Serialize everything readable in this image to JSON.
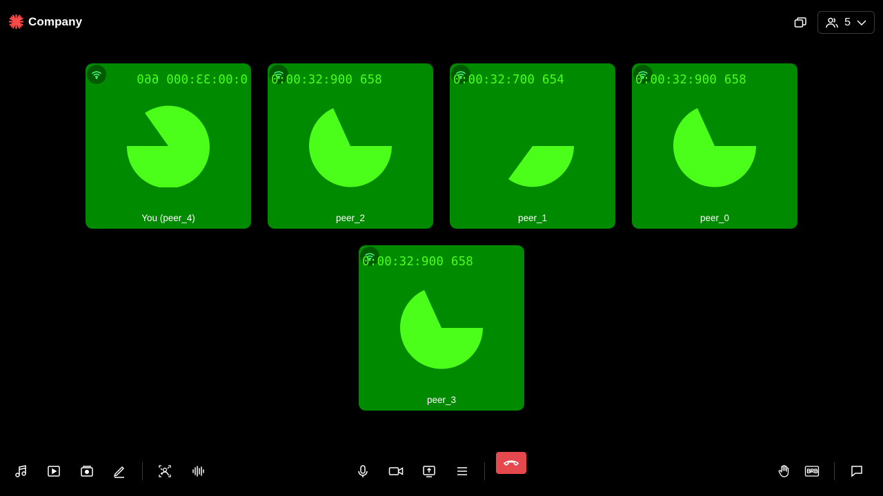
{
  "header": {
    "brand_name": "Company",
    "participant_count": "5",
    "icons": [
      "company-logo-icon",
      "pip-window-icon",
      "participants-icon",
      "chevron-down-icon"
    ]
  },
  "colors": {
    "background": "#000000",
    "tile_background": "#008a00",
    "pie_color": "#4cff1a",
    "end_call": "#e5484d"
  },
  "tiles": [
    {
      "name": "You (peer_4)",
      "timestamp": "0:00:33:000 660",
      "mirrored": true,
      "pie_filled_fraction": 0.85
    },
    {
      "name": "peer_2",
      "timestamp": "0:00:32:900 658",
      "mirrored": false,
      "pie_filled_fraction": 0.82
    },
    {
      "name": "peer_1",
      "timestamp": "0:00:32:700 654",
      "mirrored": false,
      "pie_filled_fraction": 0.35
    },
    {
      "name": "peer_0",
      "timestamp": "0:00:32:900 658",
      "mirrored": false,
      "pie_filled_fraction": 0.82
    },
    {
      "name": "peer_3",
      "timestamp": "0:00:32:900 658",
      "mirrored": false,
      "pie_filled_fraction": 0.82
    }
  ],
  "toolbar": {
    "left": [
      "music-icon",
      "video-play-icon",
      "media-library-icon",
      "pen-icon",
      "background-effects-icon",
      "audio-waveform-icon"
    ],
    "center": [
      "microphone-icon",
      "camera-icon",
      "screen-share-icon",
      "menu-icon",
      "end-call-icon"
    ],
    "right": [
      "raise-hand-icon",
      "brb-icon",
      "chat-icon"
    ]
  }
}
